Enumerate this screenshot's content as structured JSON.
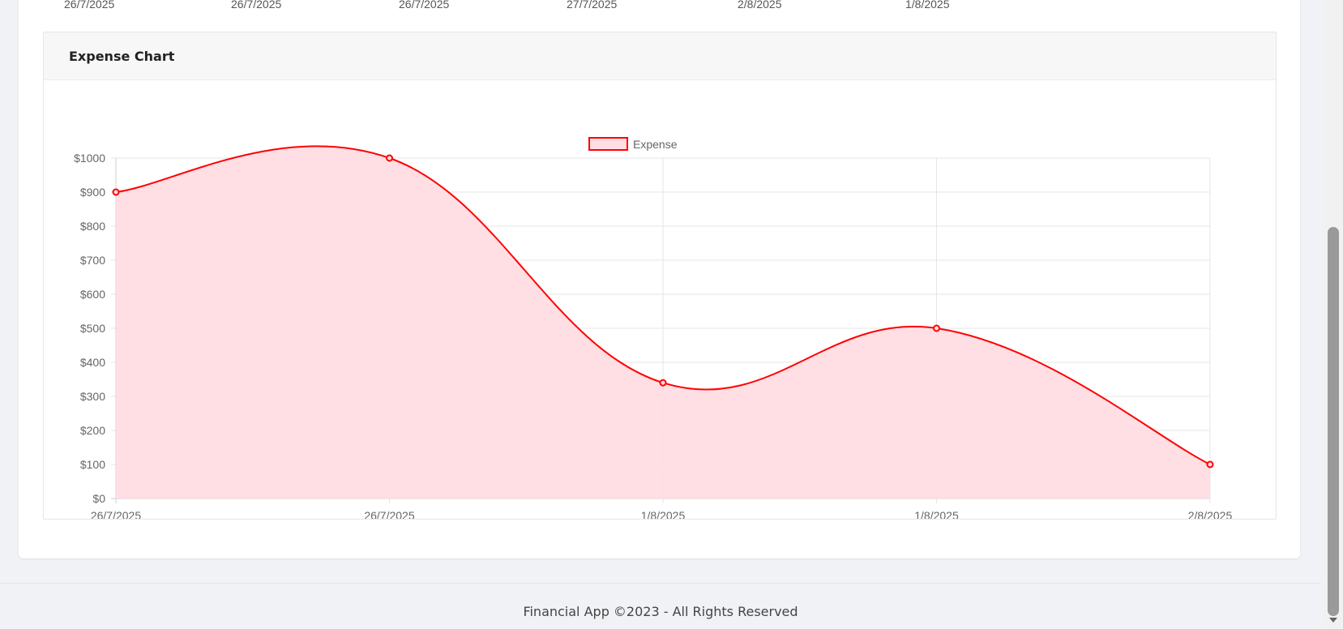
{
  "top_row_dates": [
    "26/7/2025",
    "26/7/2025",
    "26/7/2025",
    "27/7/2025",
    "2/8/2025",
    "1/8/2025"
  ],
  "expense_card": {
    "title": "Expense Chart"
  },
  "chart_data": {
    "type": "area",
    "title": "",
    "xlabel": "",
    "ylabel": "",
    "categories": [
      "26/7/2025",
      "26/7/2025",
      "1/8/2025",
      "1/8/2025",
      "2/8/2025"
    ],
    "series": [
      {
        "name": "Expense",
        "values": [
          900,
          1000,
          340,
          500,
          100
        ]
      }
    ],
    "ylim": [
      0,
      1000
    ],
    "y_ticks": [
      0,
      100,
      200,
      300,
      400,
      500,
      600,
      700,
      800,
      900,
      1000
    ],
    "y_tick_prefix": "$",
    "grid": true,
    "legend": "top-center",
    "colors": {
      "line": "#ff0000",
      "fill": "#ffdde3"
    }
  },
  "footer": {
    "text": "Financial App ©2023 - All Rights Reserved"
  }
}
